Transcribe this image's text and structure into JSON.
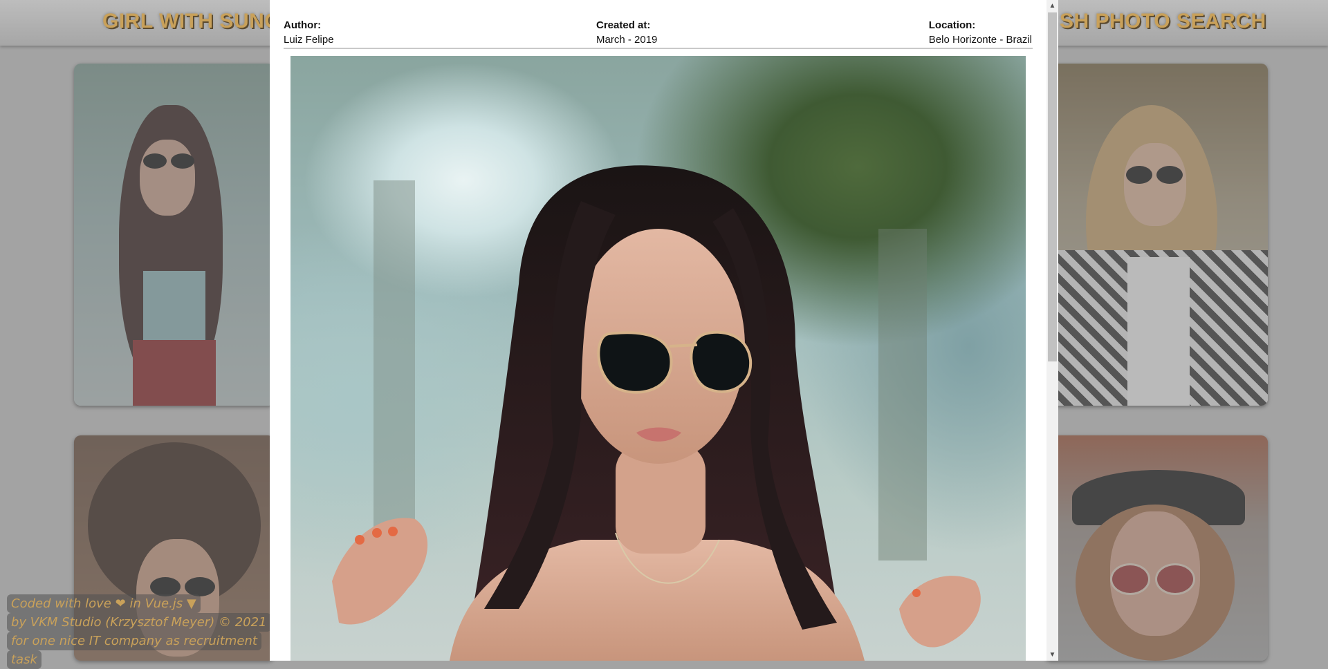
{
  "header": {
    "title_left": "GIRL WITH SUNGL",
    "title_right": "SH PHOTO SEARCH"
  },
  "modal": {
    "author_label": "Author:",
    "author_value": "Luiz Felipe",
    "created_label": "Created at:",
    "created_value": "March - 2019",
    "location_label": "Location:",
    "location_value": "Belo Horizonte - Brazil",
    "photo_alt": "Girl with sunglasses"
  },
  "footer": {
    "line1": "Coded with love",
    "line1b": "in Vue.js",
    "line2": "by  VKM Studio (Krzysztof Meyer)  © 2021",
    "line3": "for one nice IT company as recruitment",
    "line4": "task"
  },
  "colors": {
    "accent_gold": "#c9a15a",
    "overlay_gray": "#a3a3a3",
    "modal_bg": "#ffffff"
  },
  "icons": [
    "heart-icon",
    "vue-icon",
    "scroll-up-arrow-icon",
    "scroll-down-arrow-icon"
  ]
}
